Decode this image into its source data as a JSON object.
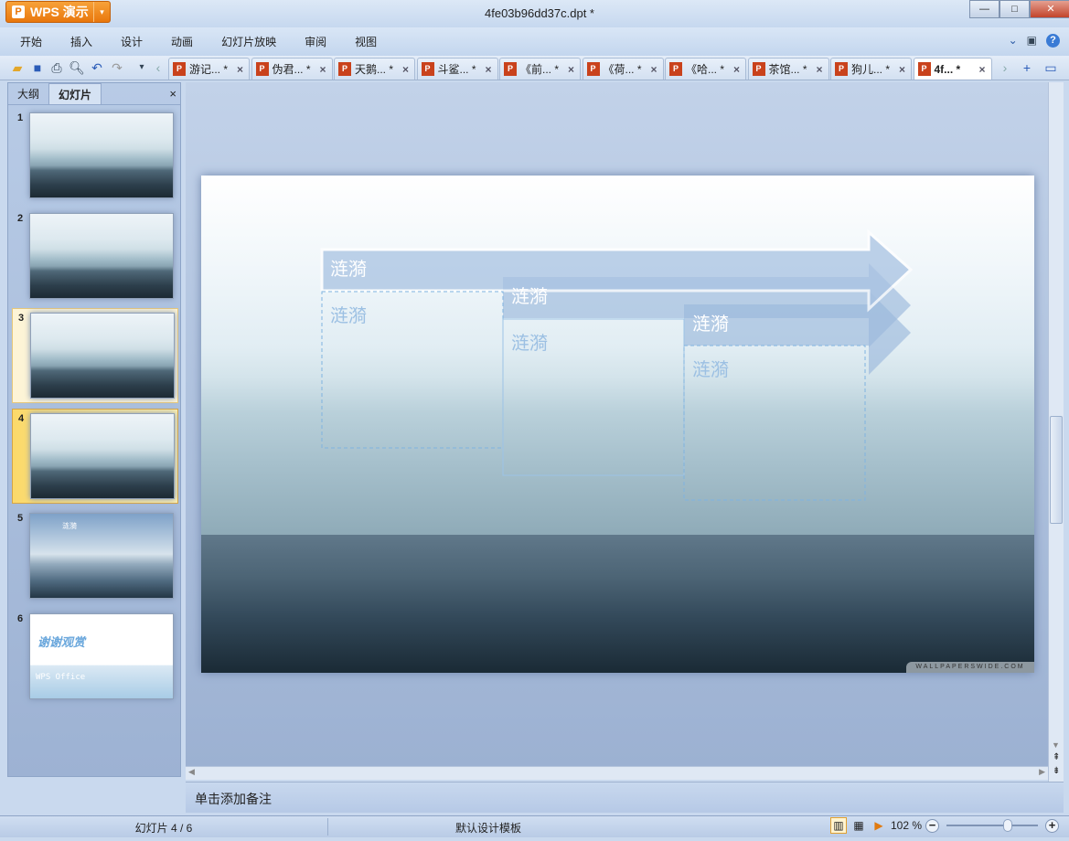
{
  "app": {
    "name": "WPS 演示",
    "doc_title": "4fe03b96dd37c.dpt *"
  },
  "window_controls": {
    "minimize": "—",
    "maximize": "□",
    "close": "✕"
  },
  "menu": [
    "开始",
    "插入",
    "设计",
    "动画",
    "幻灯片放映",
    "审阅",
    "视图"
  ],
  "menu_right": {
    "collapse": "⌄",
    "skin": "👕",
    "help": "?"
  },
  "toolbar_icons": [
    "open-folder-icon",
    "save-icon",
    "print-icon",
    "print-preview-icon",
    "undo-icon",
    "redo-icon",
    "customize-icon"
  ],
  "tabs": [
    {
      "label": "游记... *"
    },
    {
      "label": "伪君... *"
    },
    {
      "label": "天鹅... *"
    },
    {
      "label": "斗鲨... *"
    },
    {
      "label": "《前... *"
    },
    {
      "label": "《荷... *"
    },
    {
      "label": "《哈... *"
    },
    {
      "label": "茶馆... *"
    },
    {
      "label": "狗儿... *"
    },
    {
      "label": "4f... *",
      "active": true
    }
  ],
  "left_pane": {
    "tabs": [
      "大纲",
      "幻灯片"
    ],
    "active_tab": "幻灯片",
    "close": "×",
    "thumbnails": [
      {
        "num": "1"
      },
      {
        "num": "2"
      },
      {
        "num": "3"
      },
      {
        "num": "4",
        "selected": true
      },
      {
        "num": "5",
        "title": "涟漪"
      },
      {
        "num": "6",
        "title": "谢谢观赏",
        "subtitle": "WPS Office"
      }
    ]
  },
  "slide": {
    "arrows": [
      {
        "title": "涟漪",
        "body": "涟漪"
      },
      {
        "title": "涟漪",
        "body": "涟漪"
      },
      {
        "title": "涟漪",
        "body": "涟漪"
      }
    ],
    "watermark": "WALLPAPERSWIDE.COM"
  },
  "notes": {
    "placeholder": "单击添加备注"
  },
  "status": {
    "slide": "幻灯片 4 / 6",
    "template": "默认设计模板",
    "zoom": "102 %",
    "zoom_percent": 102
  },
  "colors": {
    "accent": "#e9770c",
    "arrow": "#a9c3e2",
    "text_placeholder": "#9cc0e3"
  }
}
